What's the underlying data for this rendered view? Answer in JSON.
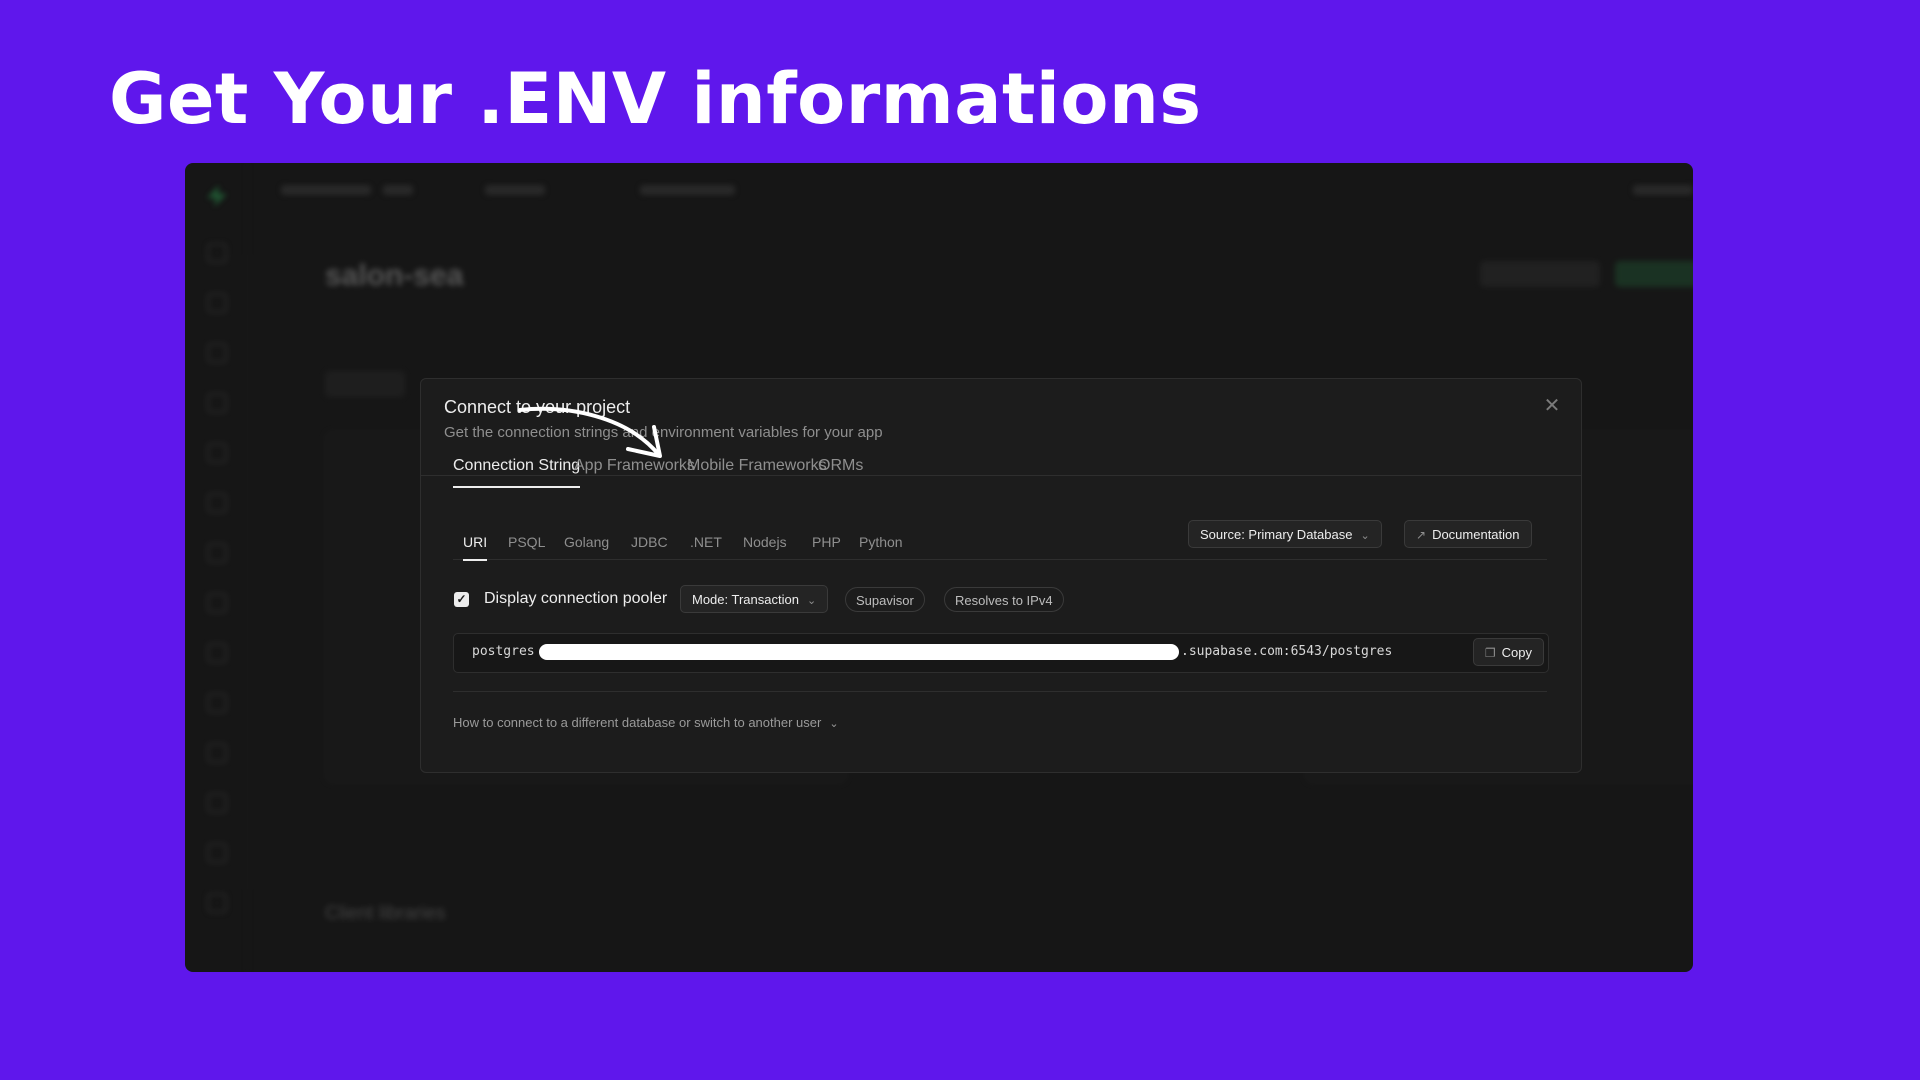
{
  "slide": {
    "title": "Get Your .ENV informations"
  },
  "dashboard": {
    "project_name": "salon-sea",
    "client_libraries_label": "Client libraries"
  },
  "modal": {
    "title": "Connect to your project",
    "subtitle": "Get the connection strings and environment variables for your app",
    "close_icon": "close-icon",
    "tabs": [
      {
        "label": "Connection String",
        "active": true
      },
      {
        "label": "App Frameworks",
        "active": false
      },
      {
        "label": "Mobile Frameworks",
        "active": false
      },
      {
        "label": "ORMs",
        "active": false
      }
    ],
    "subtabs": [
      {
        "label": "URI",
        "active": true
      },
      {
        "label": "PSQL"
      },
      {
        "label": "Golang"
      },
      {
        "label": "JDBC"
      },
      {
        "label": ".NET"
      },
      {
        "label": "Nodejs"
      },
      {
        "label": "PHP"
      },
      {
        "label": "Python"
      }
    ],
    "source_select": "Source: Primary Database",
    "documentation_button": "Documentation",
    "pooler_checkbox": {
      "checked": true,
      "label": "Display connection pooler"
    },
    "mode_select": "Mode: Transaction",
    "tags": [
      "Supavisor",
      "Resolves to IPv4"
    ],
    "connection_string": {
      "prefix": "postgres",
      "suffix": ".supabase.com:6543/postgres"
    },
    "copy_button": "Copy",
    "help_link": "How to connect to a different database or switch to another user"
  },
  "colors": {
    "slide_bg": "#5f17ec",
    "modal_bg": "#1c1c1c",
    "annotation_arrow": "#ffffff"
  }
}
